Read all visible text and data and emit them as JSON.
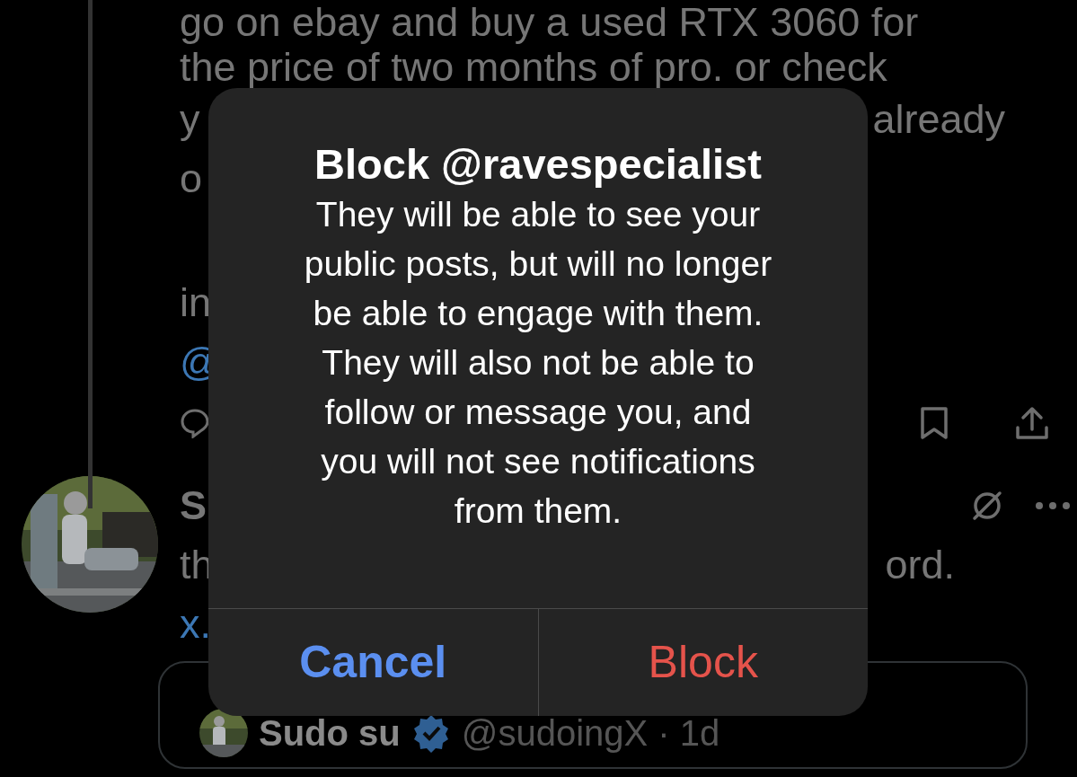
{
  "post": {
    "text_lines": [
      {
        "left": "go on ebay and buy a used RTX 3060 for"
      },
      {
        "left": "the price of two months of pro. or check"
      },
      {
        "left": "y",
        "right": "already"
      },
      {
        "left": "o"
      }
    ],
    "second_paragraph": "in",
    "mention": "@"
  },
  "reply": {
    "author": "S",
    "text_left": "th",
    "text_right": "ord.",
    "link": "x.",
    "quote": {
      "author": "Sudo su",
      "verified": true,
      "handle": "@sudoingX · 1d"
    }
  },
  "dialog": {
    "title": "Block @ravespecialist",
    "message": "They will be able to see your\npublic posts, but will no longer\nbe able to engage with them.\nThey will also not be able to\nfollow or message you, and\nyou will not see notifications\nfrom them.",
    "buttons": [
      {
        "label": "Cancel",
        "kind": "cancel"
      },
      {
        "label": "Block",
        "kind": "destructive"
      }
    ]
  }
}
